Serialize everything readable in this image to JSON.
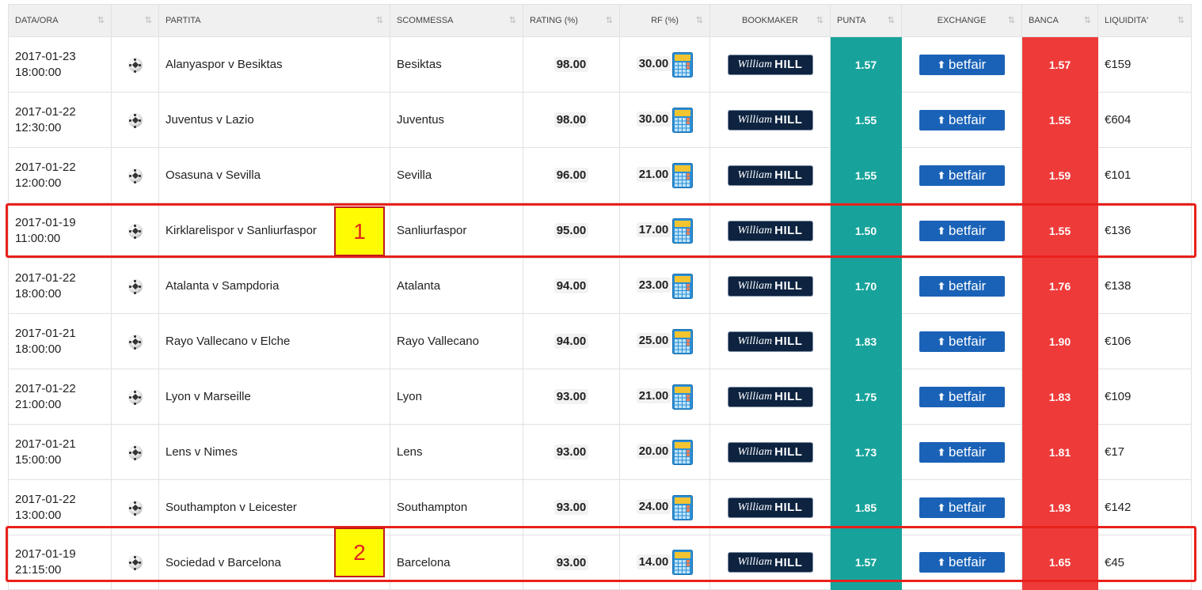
{
  "headers": [
    "DATA/ORA",
    "",
    "PARTITA",
    "SCOMMESSA",
    "RATING (%)",
    "RF (%)",
    "BOOKMAKER",
    "PUNTA",
    "EXCHANGE",
    "BANCA",
    "LIQUIDITA'"
  ],
  "sort_icon": "⇅",
  "bookmaker": {
    "logo_script": "William",
    "logo_bold": "HILL"
  },
  "exchange": {
    "logo_text": "betfair",
    "logo_icon": "⬆"
  },
  "rows": [
    {
      "date": "2017-01-23",
      "time": "18:00:00",
      "match": "Alanyaspor v Besiktas",
      "bet": "Besiktas",
      "rating": "98.00",
      "rf": "30.00",
      "punta": "1.57",
      "banca": "1.57",
      "liquidity": "€159"
    },
    {
      "date": "2017-01-22",
      "time": "12:30:00",
      "match": "Juventus v Lazio",
      "bet": "Juventus",
      "rating": "98.00",
      "rf": "30.00",
      "punta": "1.55",
      "banca": "1.55",
      "liquidity": "€604"
    },
    {
      "date": "2017-01-22",
      "time": "12:00:00",
      "match": "Osasuna v Sevilla",
      "bet": "Sevilla",
      "rating": "96.00",
      "rf": "21.00",
      "punta": "1.55",
      "banca": "1.59",
      "liquidity": "€101"
    },
    {
      "date": "2017-01-19",
      "time": "11:00:00",
      "match": "Kirklarelispor v Sanliurfaspor",
      "bet": "Sanliurfaspor",
      "rating": "95.00",
      "rf": "17.00",
      "punta": "1.50",
      "banca": "1.55",
      "liquidity": "€136"
    },
    {
      "date": "2017-01-22",
      "time": "18:00:00",
      "match": "Atalanta v Sampdoria",
      "bet": "Atalanta",
      "rating": "94.00",
      "rf": "23.00",
      "punta": "1.70",
      "banca": "1.76",
      "liquidity": "€138"
    },
    {
      "date": "2017-01-21",
      "time": "18:00:00",
      "match": "Rayo Vallecano v Elche",
      "bet": "Rayo Vallecano",
      "rating": "94.00",
      "rf": "25.00",
      "punta": "1.83",
      "banca": "1.90",
      "liquidity": "€106"
    },
    {
      "date": "2017-01-22",
      "time": "21:00:00",
      "match": "Lyon v Marseille",
      "bet": "Lyon",
      "rating": "93.00",
      "rf": "21.00",
      "punta": "1.75",
      "banca": "1.83",
      "liquidity": "€109"
    },
    {
      "date": "2017-01-21",
      "time": "15:00:00",
      "match": "Lens v Nimes",
      "bet": "Lens",
      "rating": "93.00",
      "rf": "20.00",
      "punta": "1.73",
      "banca": "1.81",
      "liquidity": "€17"
    },
    {
      "date": "2017-01-22",
      "time": "13:00:00",
      "match": "Southampton v Leicester",
      "bet": "Southampton",
      "rating": "93.00",
      "rf": "24.00",
      "punta": "1.85",
      "banca": "1.93",
      "liquidity": "€142"
    },
    {
      "date": "2017-01-19",
      "time": "21:15:00",
      "match": "Sociedad v Barcelona",
      "bet": "Barcelona",
      "rating": "93.00",
      "rf": "14.00",
      "punta": "1.57",
      "banca": "1.65",
      "liquidity": "€45"
    }
  ],
  "annotations": [
    "1",
    "2"
  ]
}
